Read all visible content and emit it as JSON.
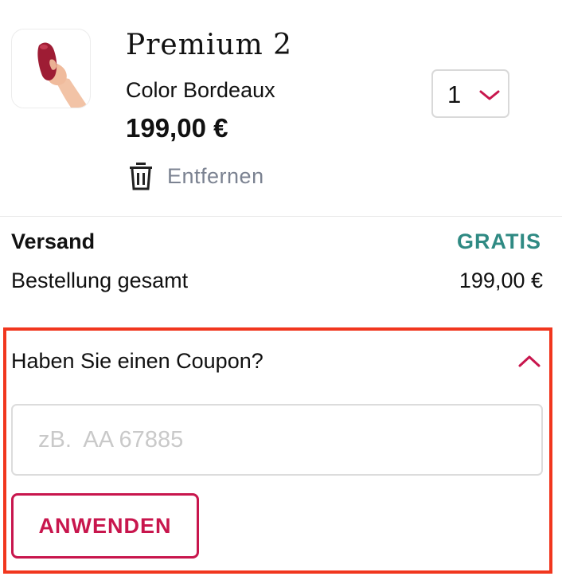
{
  "product": {
    "title": "Premium 2",
    "color": "Color Bordeaux",
    "price": "199,00 €",
    "remove_label": "Entfernen",
    "quantity": "1",
    "thumb_icon": "product-hand-icon"
  },
  "summary": {
    "shipping_label": "Versand",
    "shipping_value": "GRATIS",
    "total_label": "Bestellung gesamt",
    "total_value": "199,00 €"
  },
  "coupon": {
    "question": "Haben Sie einen Coupon?",
    "placeholder": "zB.  AA 67885",
    "value": "",
    "apply_label": "ANWENDEN",
    "expanded": true
  },
  "colors": {
    "accent": "#c8164d",
    "shipping_free": "#2f8a83",
    "highlight_border": "#f1361e",
    "muted": "#7b8291"
  }
}
